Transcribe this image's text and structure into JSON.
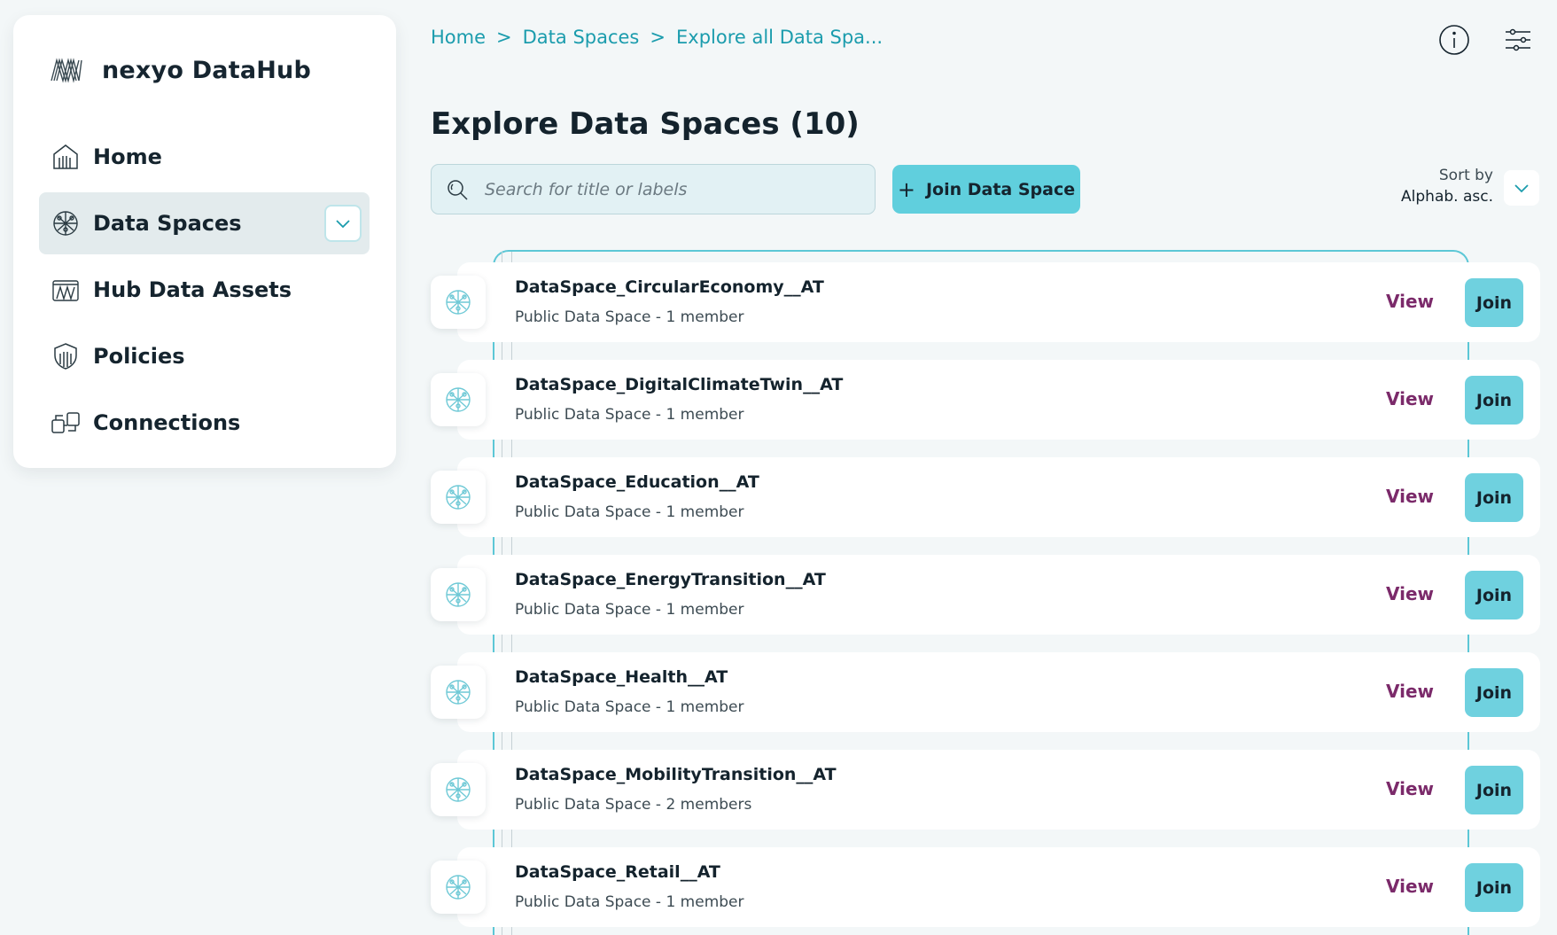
{
  "app": {
    "name": "nexyo DataHub"
  },
  "sidebar": {
    "items": [
      {
        "label": "Home",
        "icon": "home-icon"
      },
      {
        "label": "Data Spaces",
        "icon": "globe-network-icon",
        "active": true
      },
      {
        "label": "Hub Data Assets",
        "icon": "data-assets-icon"
      },
      {
        "label": "Policies",
        "icon": "shield-icon"
      },
      {
        "label": "Connections",
        "icon": "plug-icon"
      }
    ]
  },
  "header": {
    "breadcrumb": [
      "Home",
      "Data Spaces",
      "Explore all Data Spa..."
    ],
    "separator": ">",
    "info_icon": "info-icon",
    "settings_icon": "sliders-icon"
  },
  "main": {
    "title": "Explore Data Spaces (10)",
    "search": {
      "placeholder": "Search for title or labels",
      "value": ""
    },
    "join_button": {
      "label": "Join Data Space"
    },
    "sort": {
      "label": "Sort by",
      "value": "Alphab. asc."
    },
    "view_label": "View",
    "join_label": "Join",
    "rows": [
      {
        "title": "DataSpace_CircularEconomy__AT",
        "subtitle": "Public Data Space - 1 member"
      },
      {
        "title": "DataSpace_DigitalClimateTwin__AT",
        "subtitle": "Public Data Space - 1 member"
      },
      {
        "title": "DataSpace_Education__AT",
        "subtitle": "Public Data Space - 1 member"
      },
      {
        "title": "DataSpace_EnergyTransition__AT",
        "subtitle": "Public Data Space - 1 member"
      },
      {
        "title": "DataSpace_Health__AT",
        "subtitle": "Public Data Space - 1 member"
      },
      {
        "title": "DataSpace_MobilityTransition__AT",
        "subtitle": "Public Data Space - 2 members"
      },
      {
        "title": "DataSpace_Retail__AT",
        "subtitle": "Public Data Space - 1 member"
      }
    ]
  },
  "colors": {
    "accent": "#60cfdd",
    "link": "#1b9cad",
    "view": "#7b2a6a",
    "background": "#f3f7f8"
  }
}
